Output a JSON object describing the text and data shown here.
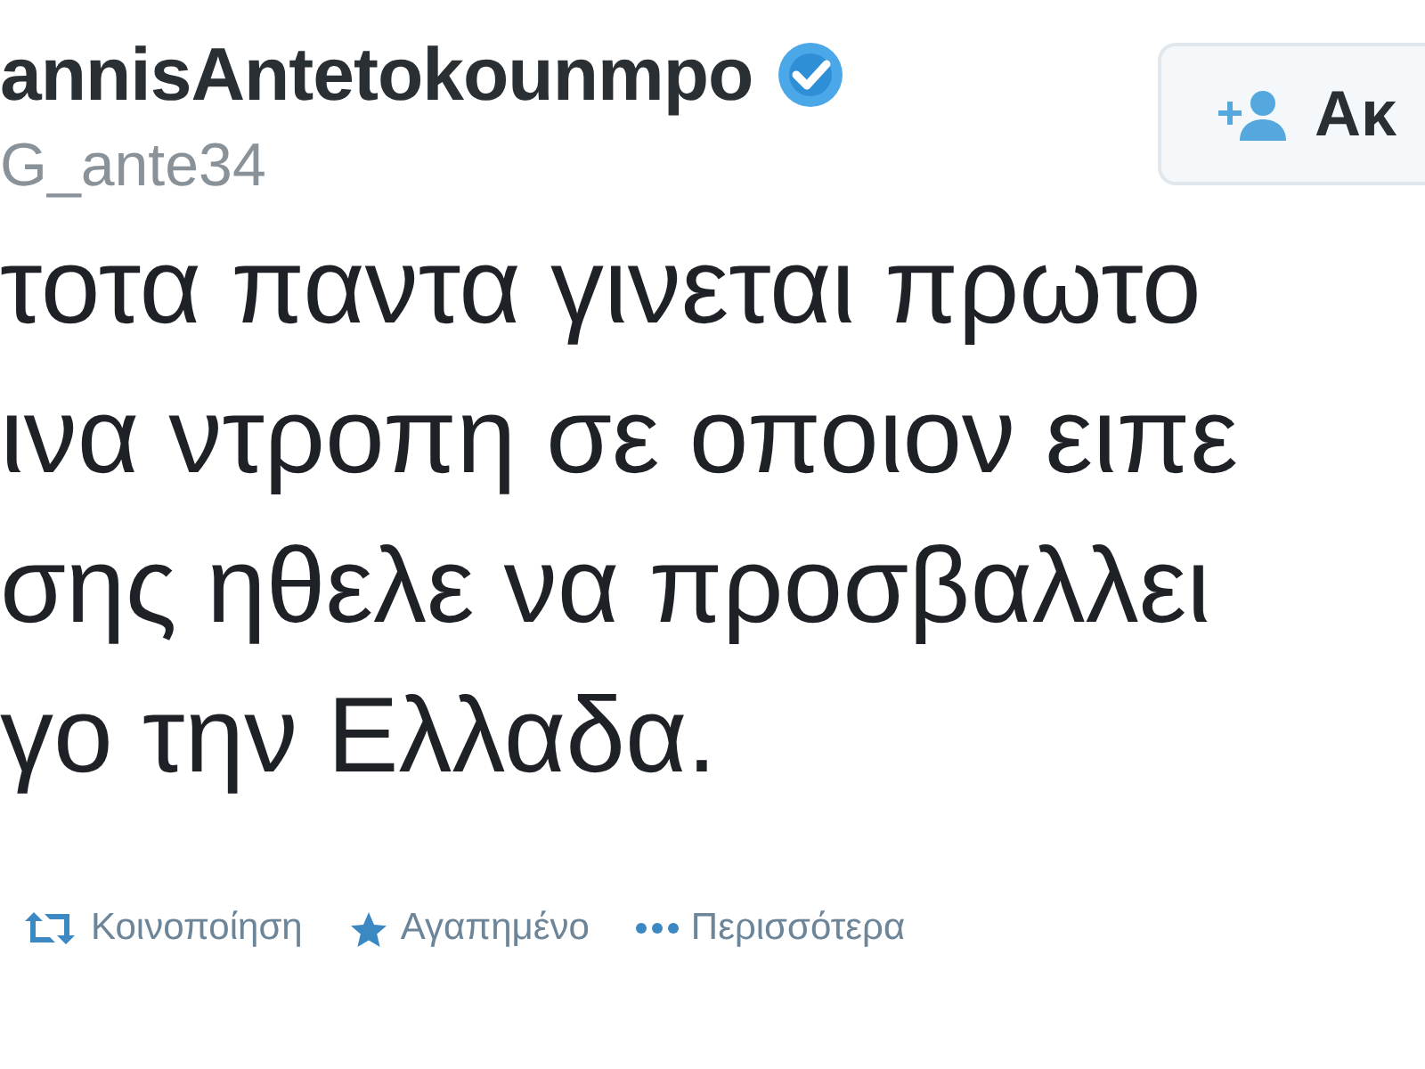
{
  "author": {
    "name": "annisAntetokounmpo",
    "verified": true,
    "handle": "G_ante34"
  },
  "follow_button": {
    "label": "Ακ"
  },
  "tweet_lines": [
    "τοτα παντα γινεται πρωτο",
    "ινα ντροπη σε οποιον ειπε",
    "σης ηθελε να προσβαλλει",
    "γο την Ελλαδα."
  ],
  "actions": [
    {
      "kind": "retweet",
      "label": "Κοινοποίηση"
    },
    {
      "kind": "favorite",
      "label": "Αγαπημένο"
    },
    {
      "kind": "more",
      "label": "Περισσότερα"
    }
  ]
}
